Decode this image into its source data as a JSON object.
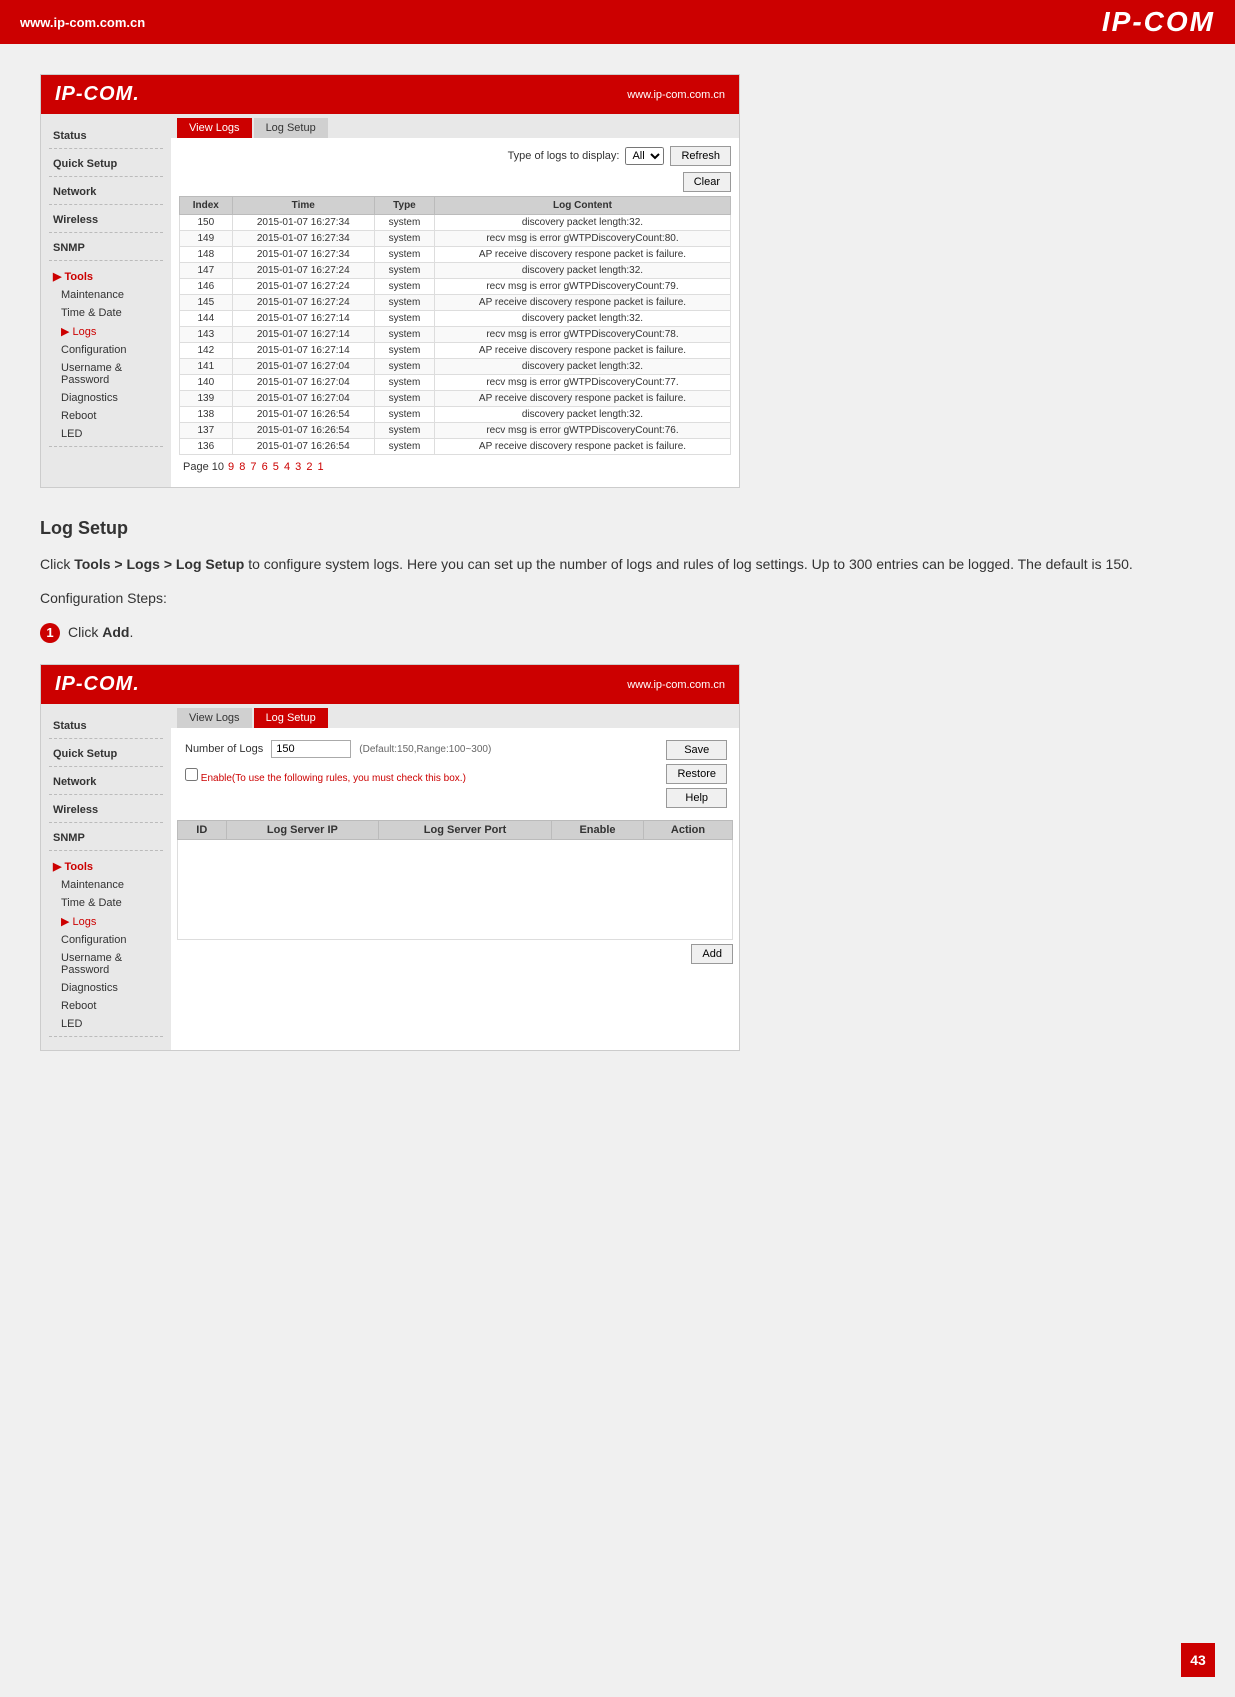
{
  "header": {
    "website": "www.ip-com.com.cn",
    "logo": "IP-COM"
  },
  "screenshot1": {
    "router_logo": "IP-COM.",
    "router_url": "www.ip-com.com.cn",
    "tabs": [
      "View Logs",
      "Log Setup"
    ],
    "active_tab": "View Logs",
    "controls": {
      "label": "Type of logs to display:",
      "select_value": "All",
      "refresh_btn": "Refresh",
      "clear_btn": "Clear"
    },
    "table_headers": [
      "Index",
      "Time",
      "Type",
      "Log Content"
    ],
    "table_rows": [
      [
        "150",
        "2015-01-07 16:27:34",
        "system",
        "discovery packet length:32."
      ],
      [
        "149",
        "2015-01-07 16:27:34",
        "system",
        "recv msg is error gWTPDiscoveryCount:80."
      ],
      [
        "148",
        "2015-01-07 16:27:34",
        "system",
        "AP receive discovery respone packet is failure."
      ],
      [
        "147",
        "2015-01-07 16:27:24",
        "system",
        "discovery packet length:32."
      ],
      [
        "146",
        "2015-01-07 16:27:24",
        "system",
        "recv msg is error gWTPDiscoveryCount:79."
      ],
      [
        "145",
        "2015-01-07 16:27:24",
        "system",
        "AP receive discovery respone packet is failure."
      ],
      [
        "144",
        "2015-01-07 16:27:14",
        "system",
        "discovery packet length:32."
      ],
      [
        "143",
        "2015-01-07 16:27:14",
        "system",
        "recv msg is error gWTPDiscoveryCount:78."
      ],
      [
        "142",
        "2015-01-07 16:27:14",
        "system",
        "AP receive discovery respone packet is failure."
      ],
      [
        "141",
        "2015-01-07 16:27:04",
        "system",
        "discovery packet length:32."
      ],
      [
        "140",
        "2015-01-07 16:27:04",
        "system",
        "recv msg is error gWTPDiscoveryCount:77."
      ],
      [
        "139",
        "2015-01-07 16:27:04",
        "system",
        "AP receive discovery respone packet is failure."
      ],
      [
        "138",
        "2015-01-07 16:26:54",
        "system",
        "discovery packet length:32."
      ],
      [
        "137",
        "2015-01-07 16:26:54",
        "system",
        "recv msg is error gWTPDiscoveryCount:76."
      ],
      [
        "136",
        "2015-01-07 16:26:54",
        "system",
        "AP receive discovery respone packet is failure."
      ]
    ],
    "pagination": {
      "prefix": "Page 10",
      "pages": [
        "9",
        "8",
        "7",
        "6",
        "5",
        "4",
        "3",
        "2",
        "1"
      ]
    },
    "sidebar": {
      "items": [
        {
          "label": "Status",
          "type": "section"
        },
        {
          "label": "Quick Setup",
          "type": "section"
        },
        {
          "label": "Network",
          "type": "section"
        },
        {
          "label": "Wireless",
          "type": "section"
        },
        {
          "label": "SNMP",
          "type": "section"
        },
        {
          "label": "Tools",
          "type": "section-active"
        },
        {
          "label": "Maintenance",
          "type": "sub"
        },
        {
          "label": "Time & Date",
          "type": "sub"
        },
        {
          "label": "Logs",
          "type": "sub-active"
        },
        {
          "label": "Configuration",
          "type": "sub"
        },
        {
          "label": "Username & Password",
          "type": "sub"
        },
        {
          "label": "Diagnostics",
          "type": "sub"
        },
        {
          "label": "Reboot",
          "type": "sub"
        },
        {
          "label": "LED",
          "type": "sub"
        }
      ]
    }
  },
  "section_title": "Log Setup",
  "body_paragraphs": [
    "Click Tools > Logs > Log Setup to configure system logs. Here you can set up the number of logs and rules of log settings. Up to 300 entries can be logged. The default is 150.",
    "Configuration Steps:"
  ],
  "step1_text": "Click Add.",
  "screenshot2": {
    "router_logo": "IP-COM.",
    "router_url": "www.ip-com.com.cn",
    "tabs": [
      "View Logs",
      "Log Setup"
    ],
    "active_tab": "Log Setup",
    "form": {
      "num_logs_label": "Number of Logs",
      "num_logs_value": "150",
      "num_logs_hint": "(Default:150,Range:100~300)",
      "enable_label": "Enable(To use the following rules, you must check this box.)",
      "save_btn": "Save",
      "restore_btn": "Restore",
      "help_btn": "Help",
      "add_btn": "Add"
    },
    "setup_table_headers": [
      "ID",
      "Log Server IP",
      "Log Server Port",
      "Enable",
      "Action"
    ],
    "sidebar": {
      "items": [
        {
          "label": "Status",
          "type": "section"
        },
        {
          "label": "Quick Setup",
          "type": "section"
        },
        {
          "label": "Network",
          "type": "section"
        },
        {
          "label": "Wireless",
          "type": "section"
        },
        {
          "label": "SNMP",
          "type": "section"
        },
        {
          "label": "Tools",
          "type": "section-active"
        },
        {
          "label": "Maintenance",
          "type": "sub"
        },
        {
          "label": "Time & Date",
          "type": "sub"
        },
        {
          "label": "Logs",
          "type": "sub-active"
        },
        {
          "label": "Configuration",
          "type": "sub"
        },
        {
          "label": "Username & Password",
          "type": "sub"
        },
        {
          "label": "Diagnostics",
          "type": "sub"
        },
        {
          "label": "Reboot",
          "type": "sub"
        },
        {
          "label": "LED",
          "type": "sub"
        }
      ]
    }
  },
  "page_number": "43"
}
